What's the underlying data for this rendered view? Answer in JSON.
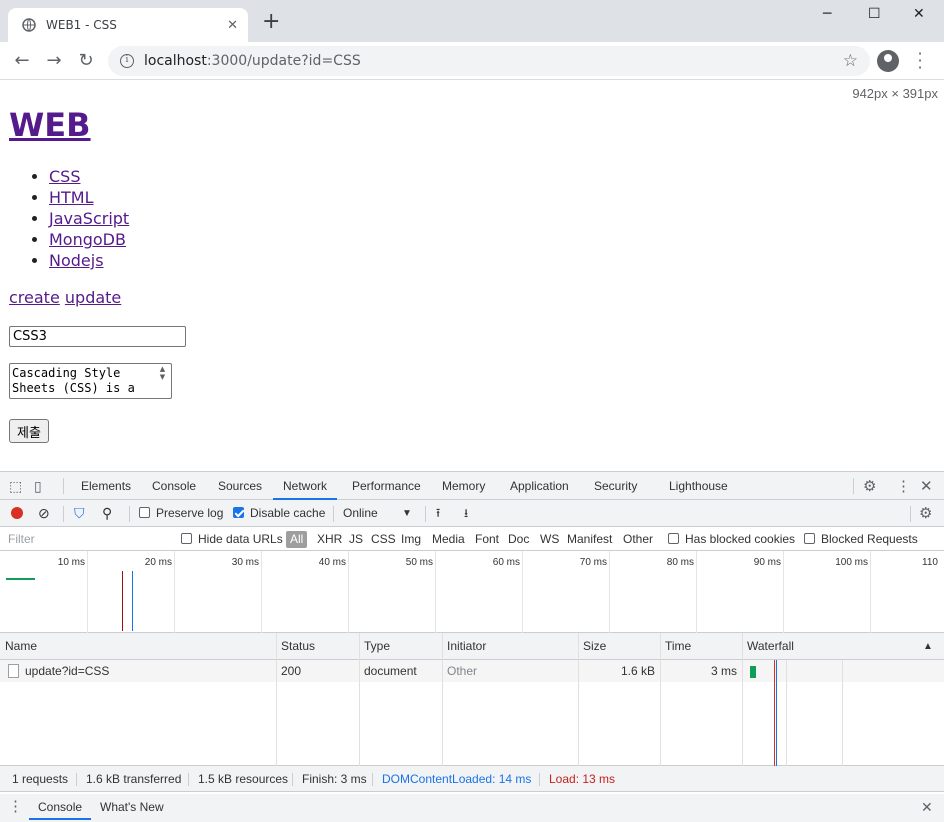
{
  "browser": {
    "tab_title": "WEB1 - CSS",
    "url_host": "localhost",
    "url_path": ":3000/update?id=CSS",
    "viewport_size": "942px × 391px"
  },
  "page": {
    "heading": "WEB",
    "nav_items": [
      "CSS",
      "HTML",
      "JavaScript",
      "MongoDB",
      "Nodejs"
    ],
    "actions": {
      "create": "create",
      "update": "update"
    },
    "title_value": "CSS3",
    "description_value": "Cascading Style Sheets (CSS) is a",
    "submit_label": "제출"
  },
  "devtools": {
    "tabs": [
      "Elements",
      "Console",
      "Sources",
      "Network",
      "Performance",
      "Memory",
      "Application",
      "Security",
      "Lighthouse"
    ],
    "active_tab": "Network",
    "toolbar": {
      "preserve_log": "Preserve log",
      "disable_cache": "Disable cache",
      "throttle": "Online"
    },
    "filter": {
      "placeholder": "Filter",
      "hide_data_urls": "Hide data URLs",
      "types": [
        "All",
        "XHR",
        "JS",
        "CSS",
        "Img",
        "Media",
        "Font",
        "Doc",
        "WS",
        "Manifest",
        "Other"
      ],
      "has_blocked_cookies": "Has blocked cookies",
      "blocked_requests": "Blocked Requests"
    },
    "overview_ticks": [
      "10 ms",
      "20 ms",
      "30 ms",
      "40 ms",
      "50 ms",
      "60 ms",
      "70 ms",
      "80 ms",
      "90 ms",
      "100 ms",
      "110"
    ],
    "table": {
      "headers": [
        "Name",
        "Status",
        "Type",
        "Initiator",
        "Size",
        "Time",
        "Waterfall"
      ],
      "rows": [
        {
          "name": "update?id=CSS",
          "status": "200",
          "type": "document",
          "initiator": "Other",
          "size": "1.6 kB",
          "time": "3 ms"
        }
      ]
    },
    "summary": {
      "requests": "1 requests",
      "transferred": "1.6 kB transferred",
      "resources": "1.5 kB resources",
      "finish": "Finish: 3 ms",
      "dom_loaded": "DOMContentLoaded: 14 ms",
      "load": "Load: 13 ms"
    },
    "drawer_tabs": [
      "Console",
      "What's New"
    ]
  },
  "colors": {
    "accent": "#1a73e8",
    "link_visited": "#551a8b",
    "dom_loaded": "#1a73e8",
    "load": "#c5221f",
    "record": "#d93025"
  }
}
